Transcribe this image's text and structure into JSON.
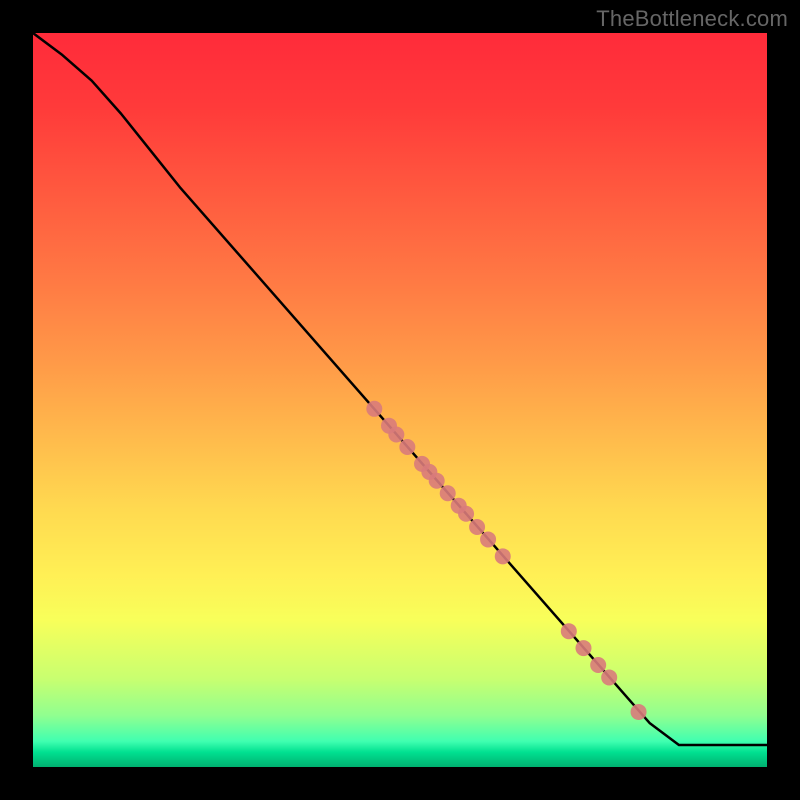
{
  "watermark": "TheBottleneck.com",
  "chart_data": {
    "type": "line",
    "title": "",
    "xlabel": "",
    "ylabel": "",
    "xlim": [
      0,
      100
    ],
    "ylim": [
      0,
      100
    ],
    "colors": {
      "line": "#000000",
      "marker_fill": "#d97b7b",
      "marker_stroke": "#d97b7b"
    },
    "gradient_bg": {
      "top": "#ff2b3a",
      "bottom": "#00b070"
    },
    "series": [
      {
        "name": "curve",
        "kind": "line",
        "x": [
          0,
          4,
          8,
          12,
          16,
          20,
          84,
          88,
          100
        ],
        "y": [
          100,
          97,
          93.5,
          89,
          84,
          79,
          6,
          3,
          3
        ]
      },
      {
        "name": "points",
        "kind": "scatter",
        "x": [
          46.5,
          48.5,
          49.5,
          51.0,
          53.0,
          54.0,
          55.0,
          56.5,
          58.0,
          59.0,
          60.5,
          62.0,
          64.0,
          73.0,
          75.0,
          77.0,
          78.5,
          82.5
        ],
        "y": [
          48.8,
          46.5,
          45.3,
          43.6,
          41.3,
          40.2,
          39.0,
          37.3,
          35.6,
          34.5,
          32.7,
          31.0,
          28.7,
          18.5,
          16.2,
          13.9,
          12.2,
          7.5
        ],
        "marker_radius_px": 8
      }
    ]
  }
}
